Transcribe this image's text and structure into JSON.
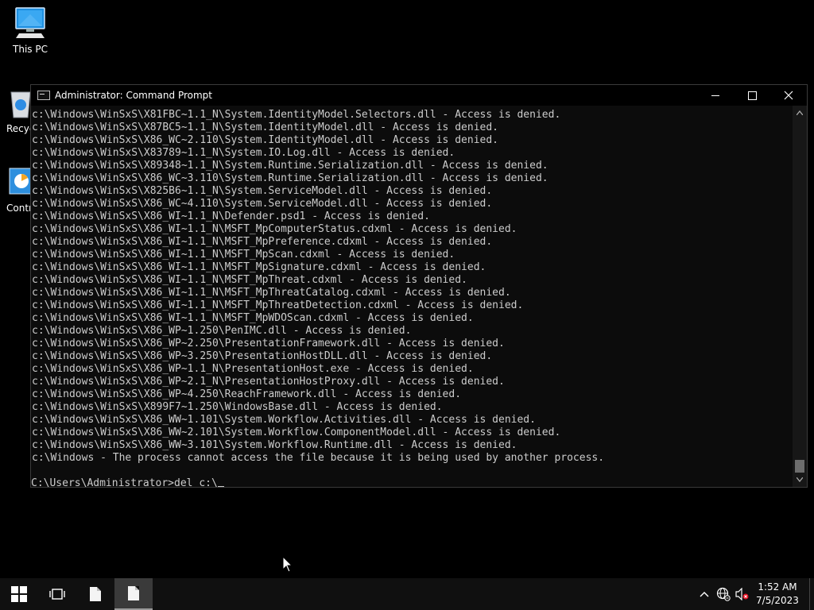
{
  "desktop": {
    "icons": [
      {
        "label": "This PC"
      },
      {
        "label": "Recycle Bin"
      },
      {
        "label": "Control Panel"
      }
    ]
  },
  "window": {
    "title": "Administrator: Command Prompt",
    "minimize_label": "—",
    "maximize_label": "☐",
    "close_label": "✕"
  },
  "console": {
    "lines": [
      "c:\\Windows\\WinSxS\\X81FBC~1.1_N\\System.IdentityModel.Selectors.dll - Access is denied.",
      "c:\\Windows\\WinSxS\\X87BC5~1.1_N\\System.IdentityModel.dll - Access is denied.",
      "c:\\Windows\\WinSxS\\X86_WC~2.110\\System.IdentityModel.dll - Access is denied.",
      "c:\\Windows\\WinSxS\\X83789~1.1_N\\System.IO.Log.dll - Access is denied.",
      "c:\\Windows\\WinSxS\\X89348~1.1_N\\System.Runtime.Serialization.dll - Access is denied.",
      "c:\\Windows\\WinSxS\\X86_WC~3.110\\System.Runtime.Serialization.dll - Access is denied.",
      "c:\\Windows\\WinSxS\\X825B6~1.1_N\\System.ServiceModel.dll - Access is denied.",
      "c:\\Windows\\WinSxS\\X86_WC~4.110\\System.ServiceModel.dll - Access is denied.",
      "c:\\Windows\\WinSxS\\X86_WI~1.1_N\\Defender.psd1 - Access is denied.",
      "c:\\Windows\\WinSxS\\X86_WI~1.1_N\\MSFT_MpComputerStatus.cdxml - Access is denied.",
      "c:\\Windows\\WinSxS\\X86_WI~1.1_N\\MSFT_MpPreference.cdxml - Access is denied.",
      "c:\\Windows\\WinSxS\\X86_WI~1.1_N\\MSFT_MpScan.cdxml - Access is denied.",
      "c:\\Windows\\WinSxS\\X86_WI~1.1_N\\MSFT_MpSignature.cdxml - Access is denied.",
      "c:\\Windows\\WinSxS\\X86_WI~1.1_N\\MSFT_MpThreat.cdxml - Access is denied.",
      "c:\\Windows\\WinSxS\\X86_WI~1.1_N\\MSFT_MpThreatCatalog.cdxml - Access is denied.",
      "c:\\Windows\\WinSxS\\X86_WI~1.1_N\\MSFT_MpThreatDetection.cdxml - Access is denied.",
      "c:\\Windows\\WinSxS\\X86_WI~1.1_N\\MSFT_MpWDOScan.cdxml - Access is denied.",
      "c:\\Windows\\WinSxS\\X86_WP~1.250\\PenIMC.dll - Access is denied.",
      "c:\\Windows\\WinSxS\\X86_WP~2.250\\PresentationFramework.dll - Access is denied.",
      "c:\\Windows\\WinSxS\\X86_WP~3.250\\PresentationHostDLL.dll - Access is denied.",
      "c:\\Windows\\WinSxS\\X86_WP~1.1_N\\PresentationHost.exe - Access is denied.",
      "c:\\Windows\\WinSxS\\X86_WP~2.1_N\\PresentationHostProxy.dll - Access is denied.",
      "c:\\Windows\\WinSxS\\X86_WP~4.250\\ReachFramework.dll - Access is denied.",
      "c:\\Windows\\WinSxS\\X899F7~1.250\\WindowsBase.dll - Access is denied.",
      "c:\\Windows\\WinSxS\\X86_WW~1.101\\System.Workflow.Activities.dll - Access is denied.",
      "c:\\Windows\\WinSxS\\X86_WW~2.101\\System.Workflow.ComponentModel.dll - Access is denied.",
      "c:\\Windows\\WinSxS\\X86_WW~3.101\\System.Workflow.Runtime.dll - Access is denied.",
      "c:\\Windows - The process cannot access the file because it is being used by another process.",
      ""
    ],
    "prompt": "C:\\Users\\Administrator>",
    "input": "del c:\\"
  },
  "taskbar": {
    "clock_time": "1:52 AM",
    "clock_date": "7/5/2023"
  },
  "colors": {
    "desktop_bg": "#000000",
    "console_bg": "#0c0c0c",
    "console_text": "#cccccc",
    "taskbar_bg": "#101010",
    "muted_x": "#e81123"
  }
}
